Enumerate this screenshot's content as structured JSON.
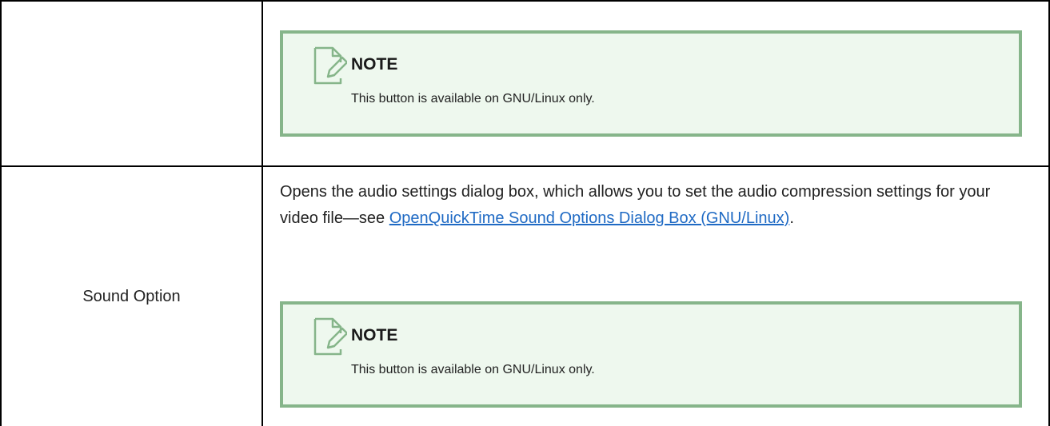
{
  "row1": {
    "note": {
      "title": "NOTE",
      "text": "This button is available on GNU/Linux only.",
      "icon": "note-pencil-icon"
    }
  },
  "row2": {
    "label": "Sound Option",
    "description_before": "Opens the audio settings dialog box, which allows you to set the audio compression settings for your video file—see ",
    "link_text": "OpenQuickTime Sound Options Dialog Box (GNU/Linux)",
    "description_after": ".",
    "note": {
      "title": "NOTE",
      "text": "This button is available on GNU/Linux only.",
      "icon": "note-pencil-icon"
    }
  },
  "colors": {
    "note_background": "#eef8ee",
    "note_border": "#86b58a",
    "link": "#1f6ac4",
    "table_border": "#000000"
  }
}
